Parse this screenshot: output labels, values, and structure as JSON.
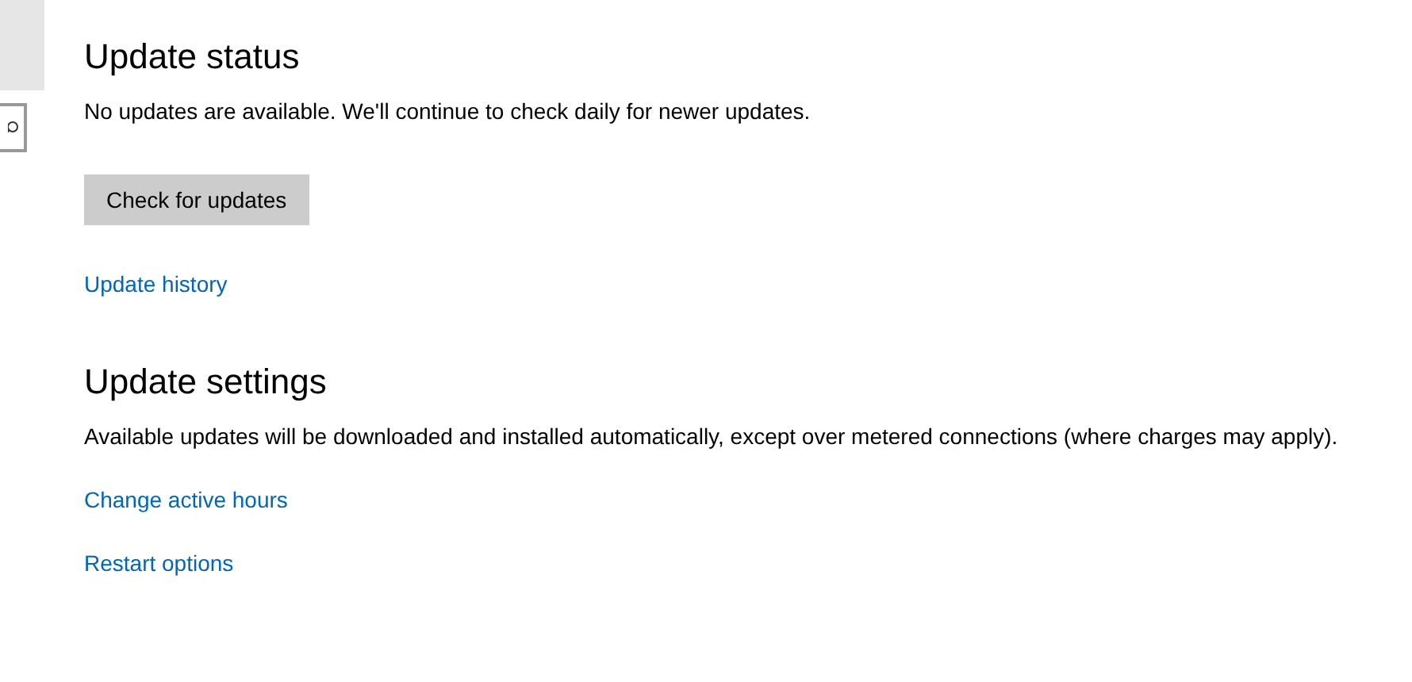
{
  "update_status": {
    "heading": "Update status",
    "message": "No updates are available. We'll continue to check daily for newer updates.",
    "button": "Check for updates",
    "link": "Update history"
  },
  "update_settings": {
    "heading": "Update settings",
    "message": "Available updates will be downloaded and installed automatically, except over metered connections (where charges may apply).",
    "links": [
      "Change active hours",
      "Restart options"
    ]
  }
}
